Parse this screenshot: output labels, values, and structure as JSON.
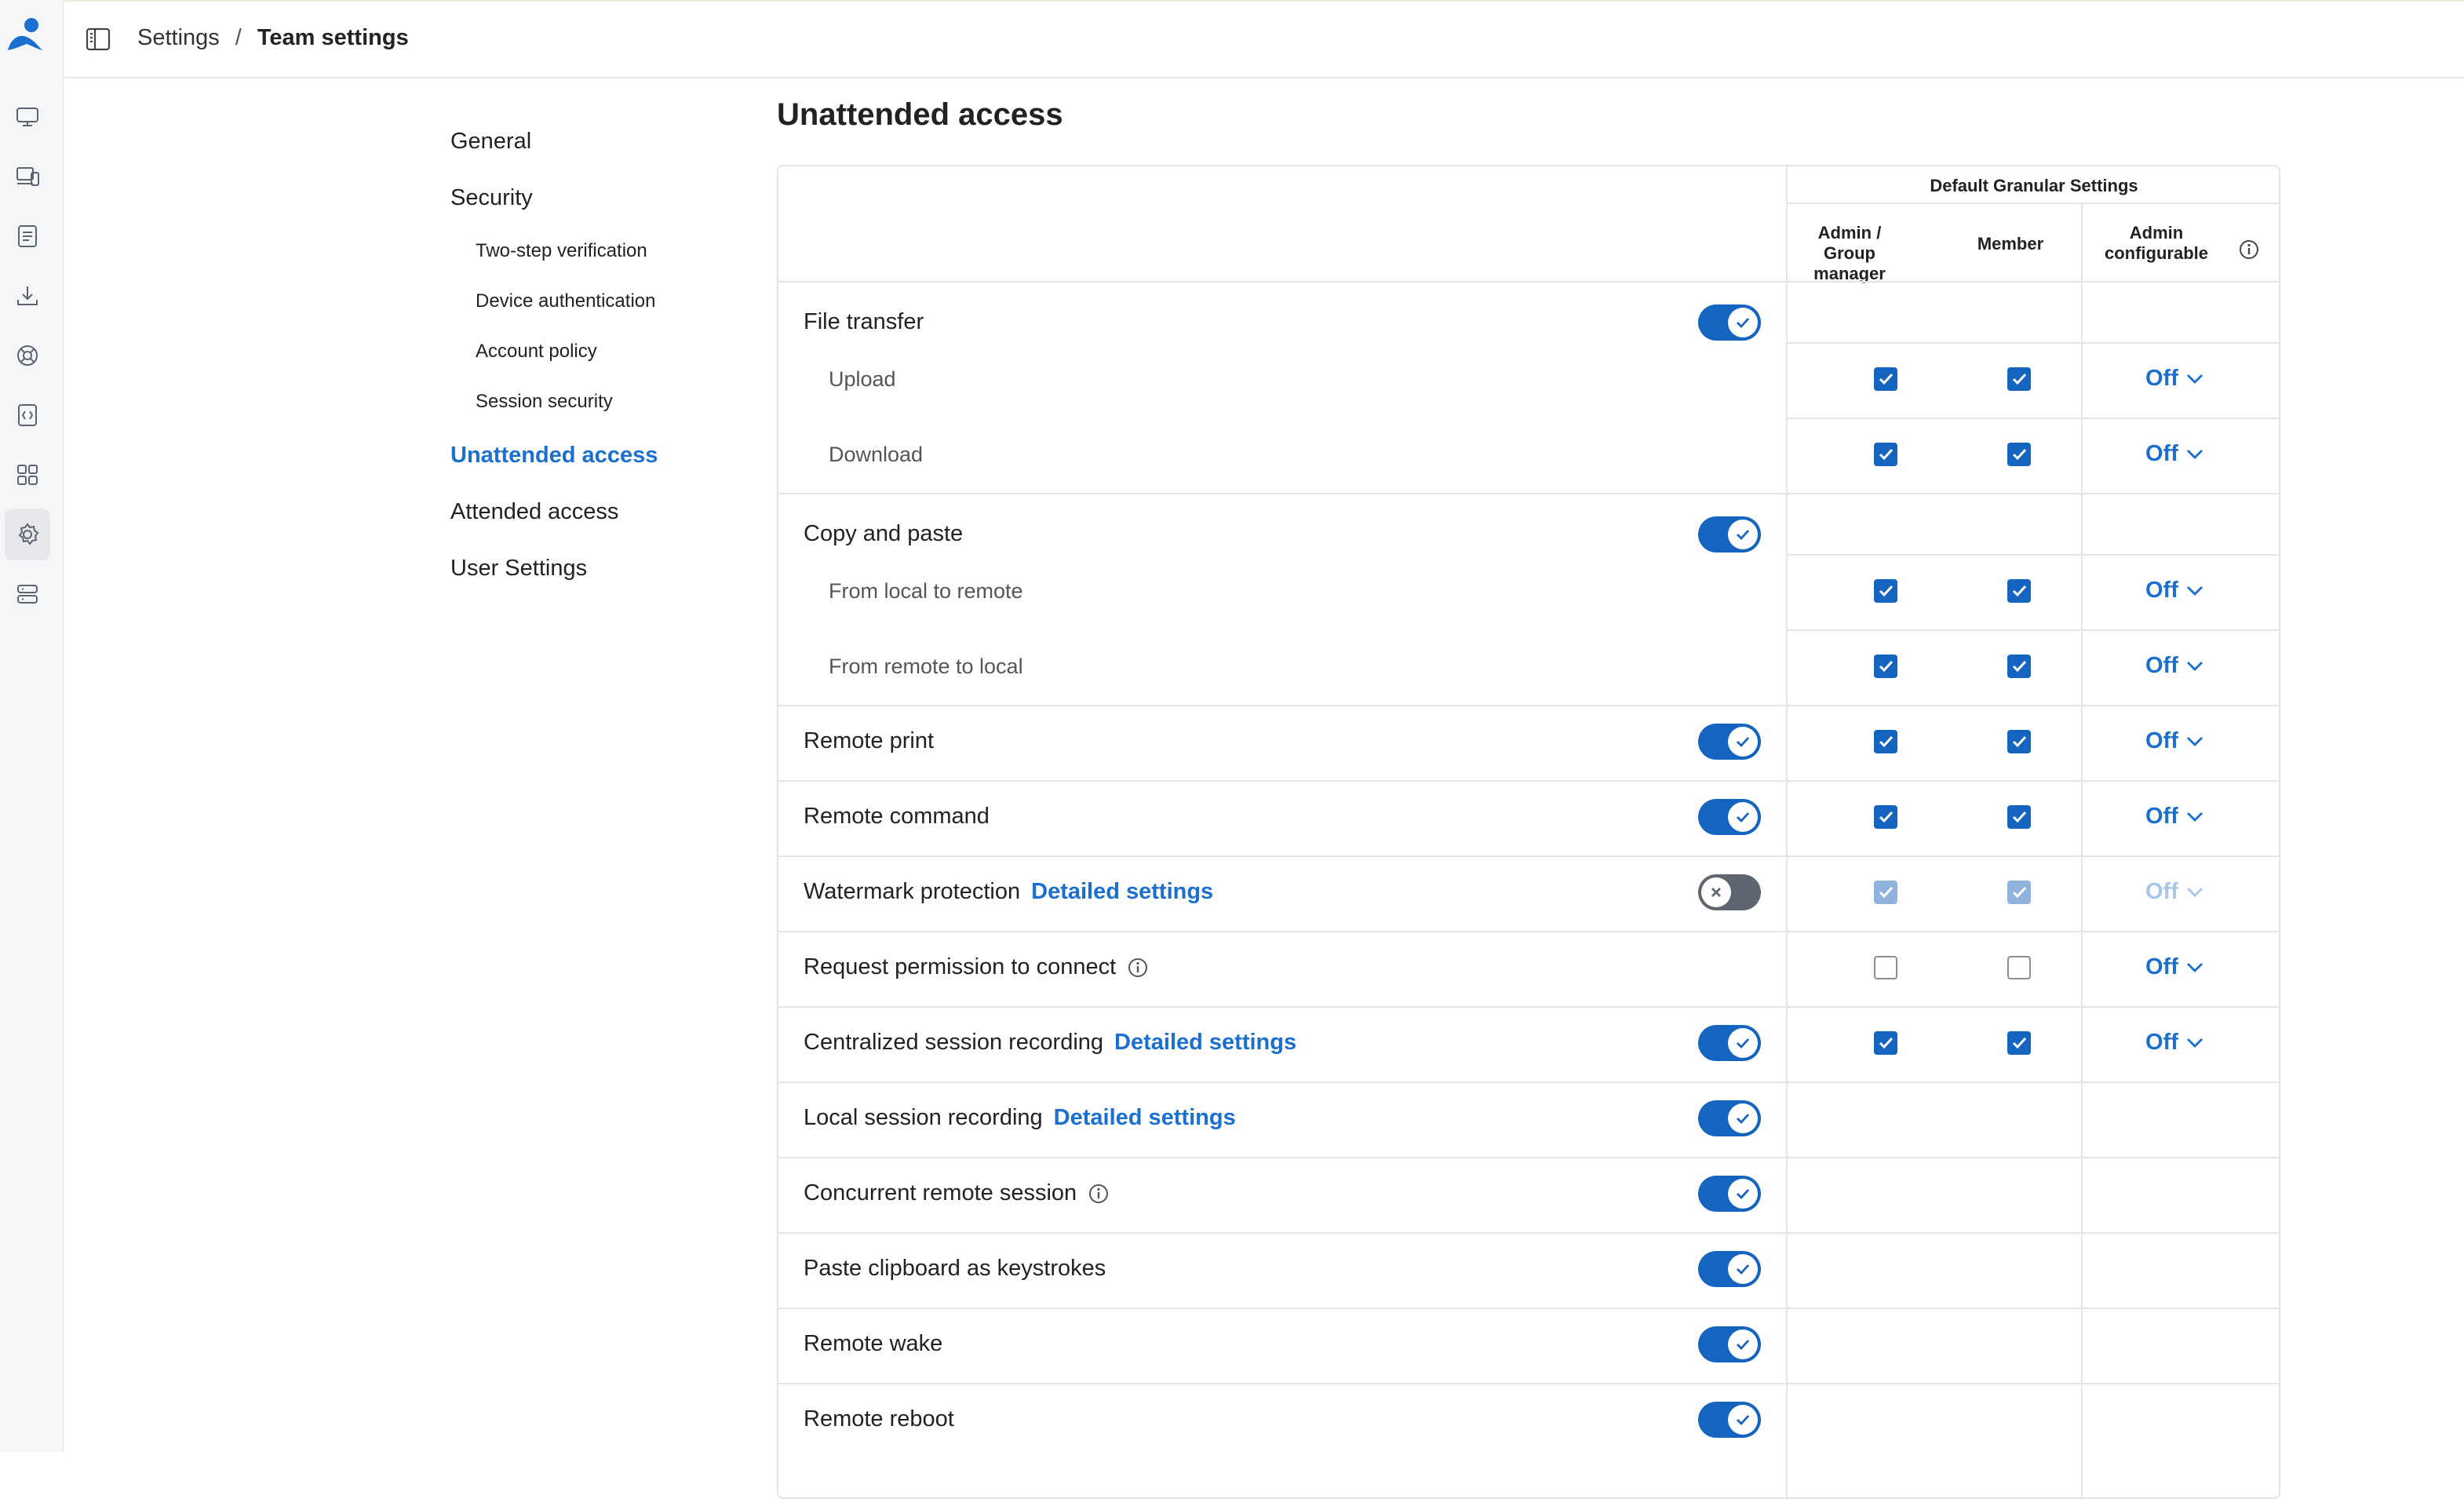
{
  "breadcrumb": {
    "root": "Settings",
    "separator": "/",
    "current": "Team settings"
  },
  "rail": {
    "icons": [
      "computer-icon",
      "devices-icon",
      "reports-icon",
      "download-icon",
      "support-icon",
      "sos-icon",
      "apps-icon",
      "settings-icon",
      "servers-icon"
    ],
    "active": "settings-icon"
  },
  "nav": {
    "general": "General",
    "security": "Security",
    "two_step": "Two-step verification",
    "device_auth": "Device authentication",
    "account_policy": "Account policy",
    "session_security": "Session security",
    "unattended": "Unattended access",
    "attended": "Attended access",
    "user_settings": "User Settings"
  },
  "page_title": "Unattended access",
  "table": {
    "group_header": "Default Granular Settings",
    "col_admin": "Admin / Group manager",
    "col_member": "Member",
    "col_configurable": "Admin configurable",
    "link_label": "Detailed settings",
    "off_label": "Off",
    "rows": {
      "file_transfer": "File transfer",
      "upload": "Upload",
      "download": "Download",
      "copy_paste": "Copy and paste",
      "local_to_remote": "From local to remote",
      "remote_to_local": "From remote to local",
      "remote_print": "Remote print",
      "remote_command": "Remote command",
      "watermark": "Watermark protection",
      "request_permission": "Request permission to connect",
      "centralized_recording": "Centralized session recording",
      "local_recording": "Local session recording",
      "concurrent_session": "Concurrent remote session",
      "paste_keystrokes": "Paste clipboard as keystrokes",
      "remote_wake": "Remote wake",
      "remote_reboot": "Remote reboot"
    }
  },
  "colors": {
    "accent": "#1565c0",
    "link": "#1a6fd0",
    "toggle_off": "#5f6670"
  }
}
